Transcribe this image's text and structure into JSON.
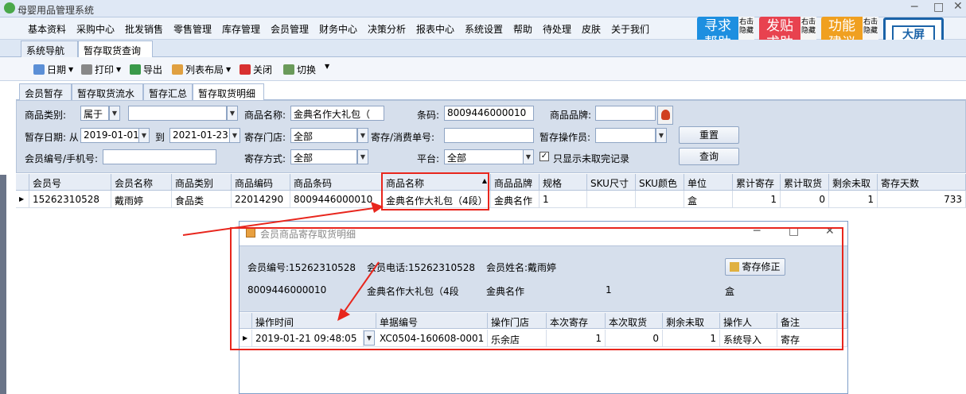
{
  "app": {
    "title": "母婴用品管理系统"
  },
  "menu": [
    "基本资料",
    "采购中心",
    "批发销售",
    "零售管理",
    "库存管理",
    "会员管理",
    "财务中心",
    "决策分析",
    "报表中心",
    "系统设置",
    "帮助",
    "待处理",
    "皮肤",
    "关于我们"
  ],
  "side_buttons": [
    {
      "label1": "寻求",
      "label2": "帮助",
      "hint": "右击隐藏",
      "color": "#1d8fe0"
    },
    {
      "label1": "发贴",
      "label2": "求助",
      "hint": "右击隐藏",
      "color": "#e8424f"
    },
    {
      "label1": "功能",
      "label2": "建议",
      "hint": "右击隐藏",
      "color": "#f0a020"
    }
  ],
  "bigscreen_label": "大屏",
  "main_tabs": [
    "系统导航图",
    "暂存取货查询"
  ],
  "toolbar": {
    "date": "日期",
    "print": "打印",
    "export": "导出",
    "layout": "列表布局",
    "close": "关闭",
    "switch": "切换"
  },
  "sub_tabs": [
    "会员暂存",
    "暂存取货流水",
    "暂存汇总",
    "暂存取货明细"
  ],
  "filter": {
    "category_label": "商品类别:",
    "category_op": "属于",
    "category_value": "",
    "name_label": "商品名称:",
    "name_value": "金典名作大礼包（",
    "barcode_label": "条码:",
    "barcode_value": "8009446000010",
    "brand_label": "商品品牌:",
    "brand_value": "",
    "date_label": "暂存日期: 从",
    "date_from": "2019-01-01",
    "date_to_label": "到",
    "date_to": "2021-01-23",
    "store_label": "寄存门店:",
    "store_value": "全部",
    "order_label": "寄存/消费单号:",
    "order_value": "",
    "operator_label": "暂存操作员:",
    "operator_value": "",
    "reset_button": "重置",
    "member_label": "会员编号/手机号:",
    "member_value": "",
    "method_label": "寄存方式:",
    "method_value": "全部",
    "platform_label": "平台:",
    "platform_value": "全部",
    "only_unpicked_label": "只显示未取完记录",
    "query_button": "查询"
  },
  "grid": {
    "headers": [
      "会员号",
      "会员名称",
      "商品类别",
      "商品编码",
      "商品条码",
      "商品名称",
      "商品品牌",
      "规格",
      "SKU尺寸",
      "SKU颜色",
      "单位",
      "累计寄存",
      "累计取货",
      "剩余未取",
      "寄存天数"
    ],
    "rows": [
      [
        "15262310528",
        "戴雨婷",
        "食品类",
        "22014290",
        "8009446000010",
        "金典名作大礼包（4段）",
        "金典名作",
        "1",
        "",
        "",
        "盒",
        "1",
        "0",
        "1",
        "733"
      ]
    ]
  },
  "dialog": {
    "title": "会员商品寄存取货明细",
    "member_no": "会员编号:15262310528",
    "member_phone": "会员电话:15262310528",
    "member_name": "会员姓名:戴雨婷",
    "fix_button": "寄存修正",
    "barcode": "8009446000010",
    "product_name": "金典名作大礼包（4段",
    "brand": "金典名作",
    "qty": "1",
    "unit": "盒",
    "headers": [
      "操作时间",
      "单据编号",
      "操作门店",
      "本次寄存",
      "本次取货",
      "剩余未取",
      "操作人",
      "备注"
    ],
    "rows": [
      [
        "2019-01-21 09:48:05",
        "XC0504-160608-0001",
        "乐余店",
        "1",
        "0",
        "1",
        "系统导入",
        "寄存"
      ]
    ]
  }
}
